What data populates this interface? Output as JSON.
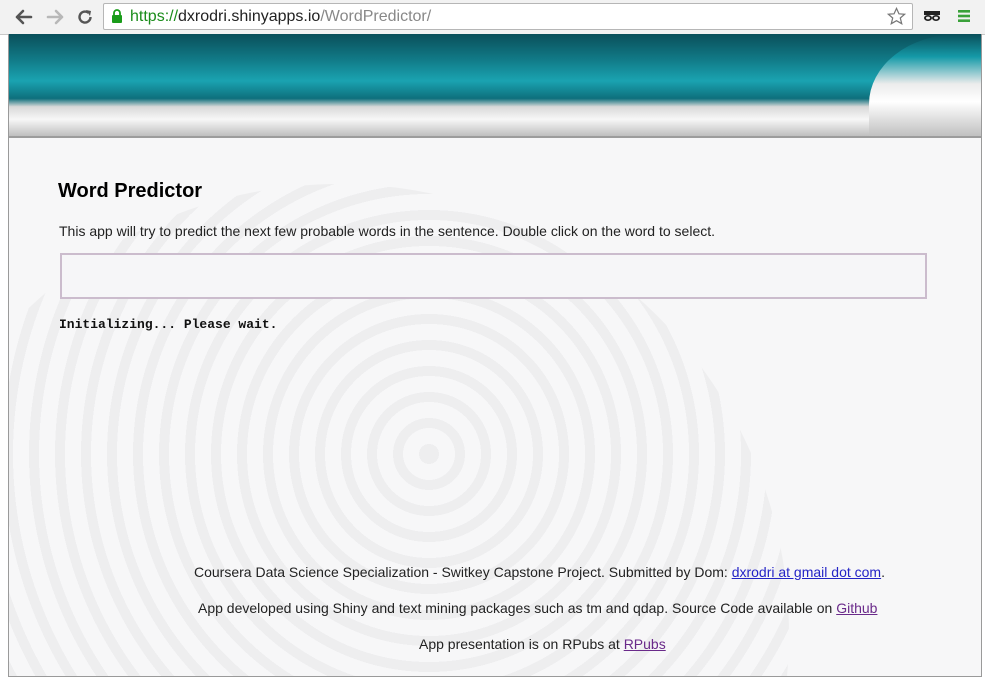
{
  "browser": {
    "url_scheme": "https://",
    "url_host": "dxrodri.shinyapps.io",
    "url_path": "/WordPredictor/"
  },
  "app": {
    "title": "Word Predictor",
    "description": "This app will try to predict the next few probable words in the sentence. Double click on the word to select.",
    "input_value": "",
    "status": "Initializing... Please wait."
  },
  "footer": {
    "line1_text": "Coursera Data Science Specialization - Switkey Capstone Project. Submitted by Dom: ",
    "line1_link": "dxrodri at gmail dot com",
    "line1_suffix": ".",
    "line2_text": "App developed using Shiny and text mining packages such as tm and qdap. Source Code available on ",
    "line2_link": "Github",
    "line3_text": "App presentation is on RPubs at ",
    "line3_link": "RPubs"
  },
  "colors": {
    "banner_teal": "#117b88",
    "url_secure": "#1a8c1a",
    "link": "#2424c6",
    "link_visited": "#6a2a8a"
  },
  "icons": [
    "back-arrow-icon",
    "forward-arrow-icon",
    "reload-icon",
    "lock-icon",
    "star-icon",
    "extension-mask-icon",
    "menu-icon"
  ]
}
